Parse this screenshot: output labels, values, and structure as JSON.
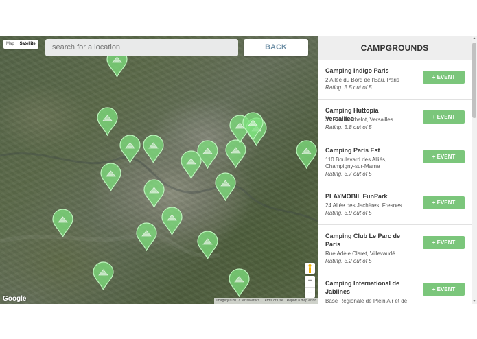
{
  "map": {
    "map_type": {
      "map_label": "Map",
      "satellite_label": "Satellite",
      "selected": "Satellite"
    },
    "search": {
      "placeholder": "search for a location"
    },
    "back_label": "BACK",
    "google_label": "Google",
    "attribution": [
      "Imagery ©2017 TerraMetrics",
      "Terms of Use",
      "Report a map error"
    ],
    "zoom_in": "+",
    "zoom_out": "−",
    "marker_color": "#7ee07e"
  },
  "sidebar": {
    "title": "CAMPGROUNDS",
    "event_label": "+ EVENT",
    "items": [
      {
        "name": "Camping Indigo Paris",
        "address": "2 Allée du Bord de l'Eau, Paris",
        "rating": "Rating: 3.5 out of 5"
      },
      {
        "name": "Camping Huttopia Versailles",
        "address": "31 Rue Berthelot, Versailles",
        "rating": "Rating: 3.8 out of 5"
      },
      {
        "name": "Camping Paris Est",
        "address": "110 Boulevard des Alliés, Champigny-sur-Marne",
        "rating": "Rating: 3.7 out of 5"
      },
      {
        "name": "PLAYMOBIL FunPark",
        "address": "24 Allée des Jachères, Fresnes",
        "rating": "Rating: 3.9 out of 5"
      },
      {
        "name": "Camping Club Le Parc de Paris",
        "address": "Rue Adèle Claret, Villevaudé",
        "rating": "Rating: 3.2 out of 5"
      },
      {
        "name": "Camping International de Jablines",
        "address": "Base Régionale de Plein Air et de",
        "rating": ""
      }
    ]
  },
  "colors": {
    "accent": "#7bc67b",
    "back_text": "#6e8fa6"
  }
}
